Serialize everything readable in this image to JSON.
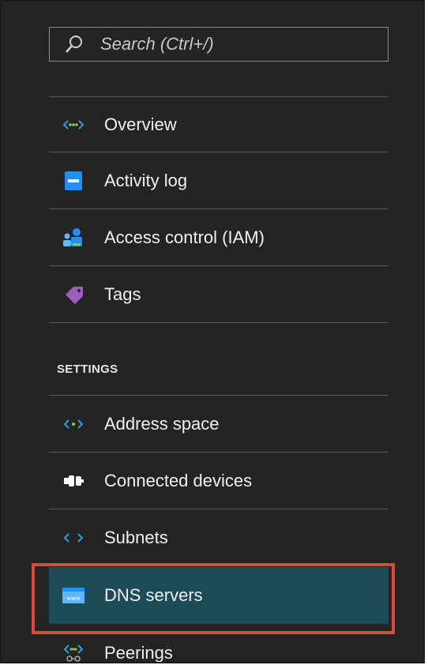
{
  "search": {
    "placeholder": "Search (Ctrl+/)"
  },
  "menu": [
    {
      "label": "Overview",
      "icon": "network-arrows-icon"
    },
    {
      "label": "Activity log",
      "icon": "log-icon"
    },
    {
      "label": "Access control (IAM)",
      "icon": "users-icon"
    },
    {
      "label": "Tags",
      "icon": "tag-icon"
    }
  ],
  "settings": {
    "title": "SETTINGS",
    "items": [
      {
        "label": "Address space",
        "icon": "code-brackets-icon"
      },
      {
        "label": "Connected devices",
        "icon": "plug-icon"
      },
      {
        "label": "Subnets",
        "icon": "code-brackets-icon"
      },
      {
        "label": "DNS servers",
        "icon": "www-icon",
        "selected": true
      },
      {
        "label": "Peerings",
        "icon": "peering-icon"
      }
    ]
  },
  "colors": {
    "background": "#242424",
    "selected_background": "#1d4c58",
    "highlight_border": "#e0463a",
    "accent": "#1e90ff"
  }
}
